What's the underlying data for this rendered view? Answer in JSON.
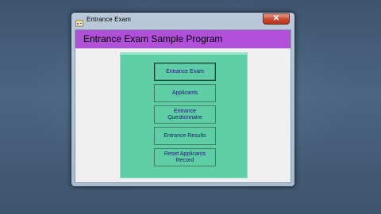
{
  "window": {
    "title": "Entrance Exam",
    "close_glyph": "✕"
  },
  "header": {
    "title": "Entrance Exam Sample Program",
    "color": "#b04fd8"
  },
  "menu": {
    "panel_color": "#5fcea6",
    "buttons": [
      {
        "label": "Entrance Exam"
      },
      {
        "label": "Applicants"
      },
      {
        "label": "Entrance Questionnaire"
      },
      {
        "label": "Entrance Results"
      },
      {
        "label": "Reset Applicants Record"
      }
    ]
  },
  "icons": {
    "app": "app-icon",
    "close": "close-icon"
  }
}
